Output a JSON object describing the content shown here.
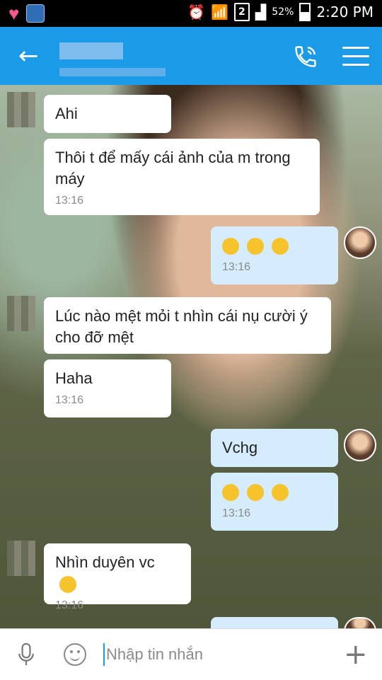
{
  "status": {
    "sim": "2",
    "battery": "52%",
    "time": "2:20 PM"
  },
  "header": {
    "back_icon": "arrow-left-icon",
    "call_icon": "phone-icon",
    "menu_icon": "hamburger-menu-icon",
    "accent": "#1b9be7"
  },
  "messages": [
    {
      "side": "in",
      "text": "Ahi"
    },
    {
      "side": "in",
      "text": "Thôi t để mấy cái ảnh của m trong máy",
      "time": "13:16"
    },
    {
      "side": "out",
      "emoji": "starry-eyes-emoji x3",
      "time": "13:16"
    },
    {
      "side": "in",
      "text": "Lúc nào mệt mỏi t nhìn cái nụ cười ý cho đỡ mệt"
    },
    {
      "side": "in",
      "text": "Haha",
      "time": "13:16"
    },
    {
      "side": "out",
      "text": "Vchg"
    },
    {
      "side": "out",
      "emoji": "laughing-tears-emoji x3",
      "time": "13:16"
    },
    {
      "side": "in",
      "text": "Nhìn duyên vc",
      "emoji": "sunglasses-emoji",
      "time": "13:16"
    }
  ],
  "input": {
    "placeholder": "Nhập tin nhắn",
    "mic_icon": "microphone-icon",
    "emoji_icon": "smiley-icon",
    "add_icon": "plus-icon"
  }
}
